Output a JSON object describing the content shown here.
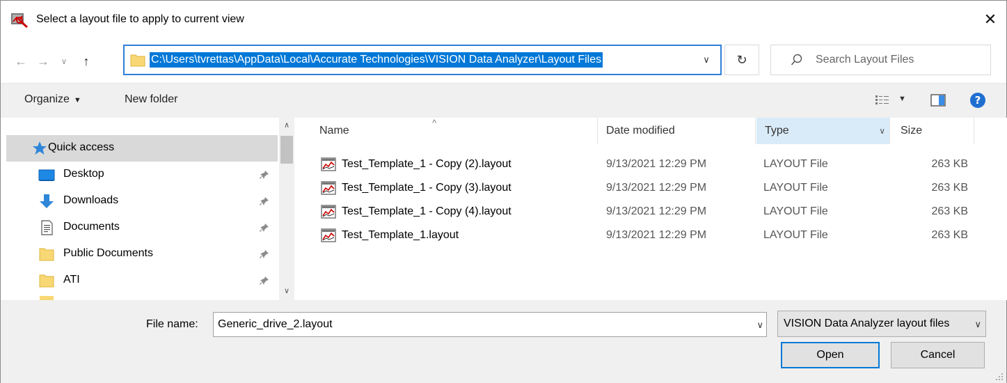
{
  "window": {
    "title": "Select a layout file to apply to current view",
    "close_label": "✕"
  },
  "nav": {
    "address_path": "C:\\Users\\tvrettas\\AppData\\Local\\Accurate Technologies\\VISION Data Analyzer\\Layout Files",
    "search_placeholder": "Search Layout Files"
  },
  "toolbar": {
    "organize_label": "Organize",
    "new_folder_label": "New folder"
  },
  "sidebar": {
    "items": [
      {
        "label": "Quick access",
        "icon": "star-icon",
        "pinned": false,
        "selected": true
      },
      {
        "label": "Desktop",
        "icon": "desktop-icon",
        "pinned": true
      },
      {
        "label": "Downloads",
        "icon": "download-arrow-icon",
        "pinned": true
      },
      {
        "label": "Documents",
        "icon": "documents-icon",
        "pinned": true
      },
      {
        "label": "Public Documents",
        "icon": "folder-icon",
        "pinned": true
      },
      {
        "label": "ATI",
        "icon": "folder-icon",
        "pinned": true
      }
    ]
  },
  "filelist": {
    "columns": {
      "name": "Name",
      "date": "Date modified",
      "type": "Type",
      "size": "Size"
    },
    "rows": [
      {
        "name": "Test_Template_1 - Copy (2).layout",
        "date": "9/13/2021 12:29 PM",
        "type": "LAYOUT File",
        "size": "263 KB"
      },
      {
        "name": "Test_Template_1 - Copy (3).layout",
        "date": "9/13/2021 12:29 PM",
        "type": "LAYOUT File",
        "size": "263 KB"
      },
      {
        "name": "Test_Template_1 - Copy (4).layout",
        "date": "9/13/2021 12:29 PM",
        "type": "LAYOUT File",
        "size": "263 KB"
      },
      {
        "name": "Test_Template_1.layout",
        "date": "9/13/2021 12:29 PM",
        "type": "LAYOUT File",
        "size": "263 KB"
      }
    ]
  },
  "footer": {
    "file_name_label": "File name:",
    "file_name_value": "Generic_drive_2.layout",
    "filter_value": "VISION Data Analyzer layout files",
    "open_label": "Open",
    "cancel_label": "Cancel"
  },
  "colors": {
    "accent": "#0078d7",
    "selection": "#d9d9d9",
    "sorted_column": "#d9ebf9"
  }
}
